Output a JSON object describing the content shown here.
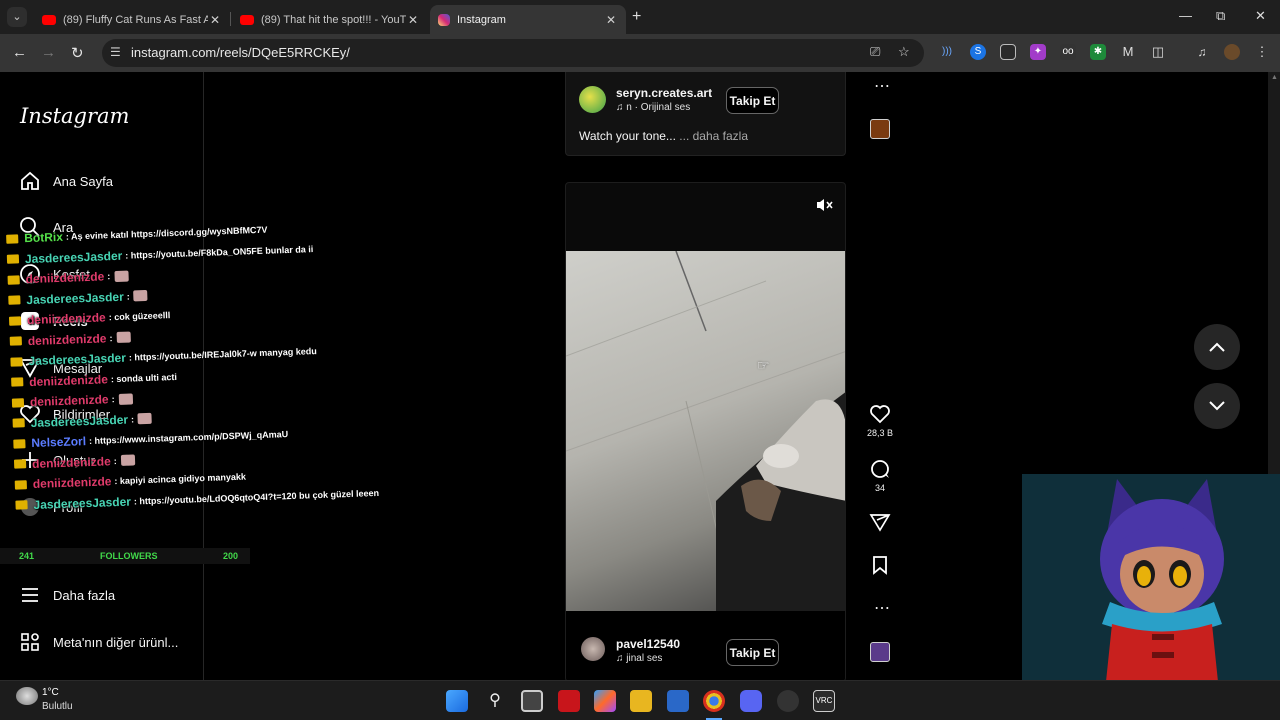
{
  "browser": {
    "tabs": [
      {
        "title": "(89) Fluffy Cat Runs As Fast As /",
        "favicon": "youtube-icon",
        "active": false
      },
      {
        "title": "(89) That hit the spot!!! - YouTu",
        "favicon": "youtube-icon",
        "active": false
      },
      {
        "title": "Instagram",
        "favicon": "instagram-icon",
        "active": true
      }
    ],
    "url": "instagram.com/reels/DQeE5RRCKEy/"
  },
  "instagram": {
    "logo": "Instagram",
    "nav": [
      {
        "label": "Ana Sayfa",
        "icon": "home-icon"
      },
      {
        "label": "Ara",
        "icon": "search-icon"
      },
      {
        "label": "Keşfet",
        "icon": "compass-icon"
      },
      {
        "label": "Reels",
        "icon": "reels-icon"
      },
      {
        "label": "Mesajlar",
        "icon": "messenger-icon"
      },
      {
        "label": "Bildirimler",
        "icon": "heart-icon"
      },
      {
        "label": "Oluştur",
        "icon": "plus-icon"
      },
      {
        "label": "Profil",
        "icon": "profile-icon"
      },
      {
        "label": "Daha fazla",
        "icon": "menu-icon"
      },
      {
        "label": "Meta'nın diğer ürünl...",
        "icon": "grid-icon"
      }
    ],
    "previous_reel": {
      "username": "seryn.creates.art",
      "audio": "n · Orijinal ses",
      "follow": "Takip Et",
      "caption": "Watch your tone...",
      "more": "... daha fazla"
    },
    "current_reel": {
      "username": "pavel12540",
      "audio": "jinal ses",
      "follow": "Takip Et",
      "likes": "28,3 B",
      "comments": "34"
    }
  },
  "chat_overlay": {
    "lines": [
      {
        "user": "BotRix",
        "color": "#55e04a",
        "msg": ": Aş evine katıl https://discord.gg/wysNBfMC7V"
      },
      {
        "user": "JasdereesJasder",
        "color": "#47d3b3",
        "msg": ": https://youtu.be/F8kDa_ON5FE bunlar da ii"
      },
      {
        "user": "deniizdenizde",
        "color": "#e03b6b",
        "msg": ":"
      },
      {
        "user": "JasdereesJasder",
        "color": "#47d3b3",
        "msg": ":"
      },
      {
        "user": "deniizdenizde",
        "color": "#e03b6b",
        "msg": ": cok güzeeelll"
      },
      {
        "user": "deniizdenizde",
        "color": "#e03b6b",
        "msg": ":"
      },
      {
        "user": "JasdereesJasder",
        "color": "#47d3b3",
        "msg": ": https://youtu.be/IREJal0k7-w manyag kedu"
      },
      {
        "user": "deniizdenizde",
        "color": "#e03b6b",
        "msg": ": sonda ulti acti"
      },
      {
        "user": "deniizdenizde",
        "color": "#e03b6b",
        "msg": ":"
      },
      {
        "user": "JasdereesJasder",
        "color": "#47d3b3",
        "msg": ":"
      },
      {
        "user": "NelseZorl",
        "color": "#5b7cff",
        "msg": ": https://www.instagram.com/p/DSPWj_qAmaU"
      },
      {
        "user": "deniizdenizde",
        "color": "#e03b6b",
        "msg": ":"
      },
      {
        "user": "deniizdenizde",
        "color": "#e03b6b",
        "msg": ": kapiyi acinca gidiyo manyakk"
      },
      {
        "user": "JasdereesJasder",
        "color": "#47d3b3",
        "msg": ": https://youtu.be/LdOQ6qtoQ4I?t=120 bu çok güzel leeen"
      }
    ],
    "followers_left": "241",
    "followers_label": "FOLLOWERS",
    "followers_right": "200"
  },
  "taskbar": {
    "weather_temp": "1°C",
    "weather_desc": "Bulutlu"
  }
}
